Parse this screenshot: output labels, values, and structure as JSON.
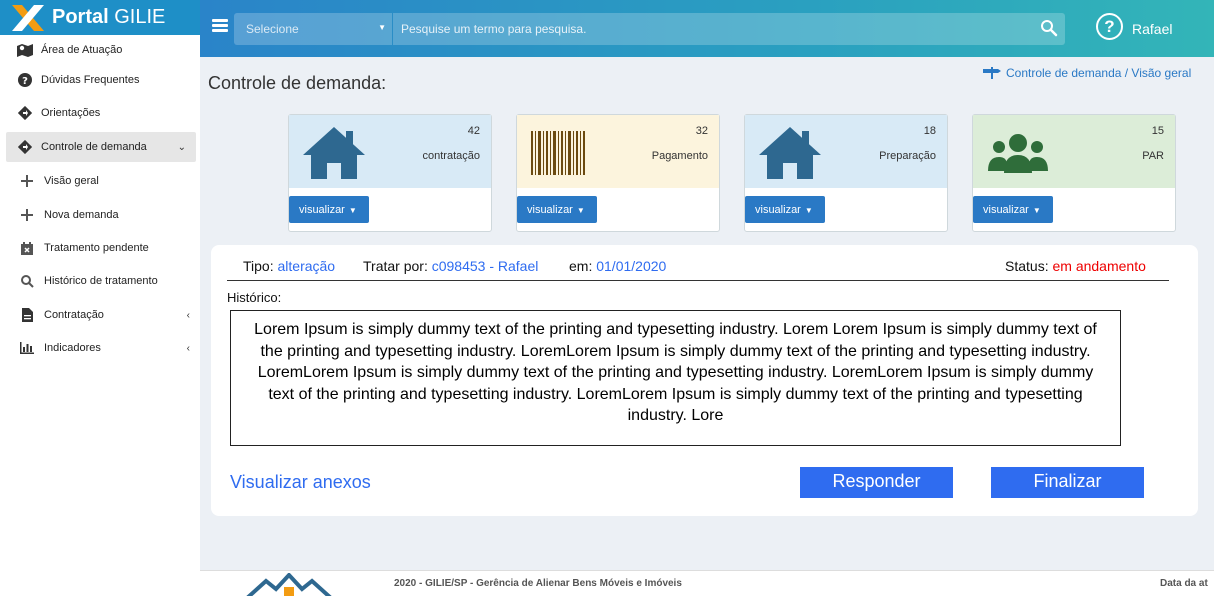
{
  "brand": {
    "title_bold": "Portal",
    "title_rest": " GILIE"
  },
  "topbar": {
    "select_placeholder": "Selecione",
    "search_placeholder": "Pesquise um termo para pesquisa.",
    "user_name": "Rafael",
    "help_glyph": "?"
  },
  "sidebar": {
    "items": [
      {
        "label": "Área de Atuação",
        "icon": "map-icon"
      },
      {
        "label": "Dúvidas Frequentes",
        "icon": "question-circle-icon"
      },
      {
        "label": "Orientações",
        "icon": "diamond-arrow-icon"
      },
      {
        "label": "Controle de demanda",
        "icon": "diamond-arrow-icon"
      },
      {
        "label": "Visão geral",
        "icon": "plus-icon"
      },
      {
        "label": "Nova demanda",
        "icon": "plus-icon"
      },
      {
        "label": "Tratamento pendente",
        "icon": "calendar-x-icon"
      },
      {
        "label": "Histórico de tratamento",
        "icon": "search-icon"
      },
      {
        "label": "Contratação",
        "icon": "document-icon"
      },
      {
        "label": "Indicadores",
        "icon": "bar-chart-icon"
      }
    ]
  },
  "page": {
    "title": "Controle de demanda:",
    "breadcrumb": "Controle de demanda / Visão geral"
  },
  "cards": [
    {
      "count": "42",
      "label": "contratação",
      "button": "visualizar",
      "icon": "house-icon",
      "bg": "#d8eaf6"
    },
    {
      "count": "32",
      "label": "Pagamento",
      "button": "visualizar",
      "icon": "barcode-icon",
      "bg": "#fcf4dd"
    },
    {
      "count": "18",
      "label": "Preparação",
      "button": "visualizar",
      "icon": "house-icon",
      "bg": "#d8eaf6"
    },
    {
      "count": "15",
      "label": "PAR",
      "button": "visualizar",
      "icon": "users-icon",
      "bg": "#dcedd8"
    }
  ],
  "detail": {
    "tipo_label": "Tipo:",
    "tipo_value": "alteração",
    "tratar_label": "Tratar por:",
    "tratar_value": "c098453 - Rafael",
    "em_label": "em:",
    "em_value": "01/01/2020",
    "status_label": "Status:",
    "status_value": "em andamento",
    "historico_label": "Histórico:",
    "historico_text": "Lorem Ipsum is simply dummy text of the printing and typesetting industry. Lorem Lorem Ipsum is simply dummy text of the printing and typesetting industry. LoremLorem Ipsum is simply dummy text of the printing and typesetting industry. LoremLorem Ipsum is simply dummy text of the printing and typesetting industry. LoremLorem Ipsum is simply dummy text of the printing and typesetting industry. LoremLorem Ipsum is simply dummy text of the printing and typesetting industry. Lore",
    "anexos_link": "Visualizar anexos",
    "responder_button": "Responder",
    "finalizar_button": "Finalizar"
  },
  "footer": {
    "text": "2020 - GILIE/SP - Gerência de Alienar Bens Móveis e Imóveis",
    "right_text": "Data da at"
  },
  "colors": {
    "primary": "#2f6cf0",
    "header": "#2a9bc4",
    "house": "#2e6890",
    "users": "#2f6d3a",
    "status": "#e00000"
  }
}
